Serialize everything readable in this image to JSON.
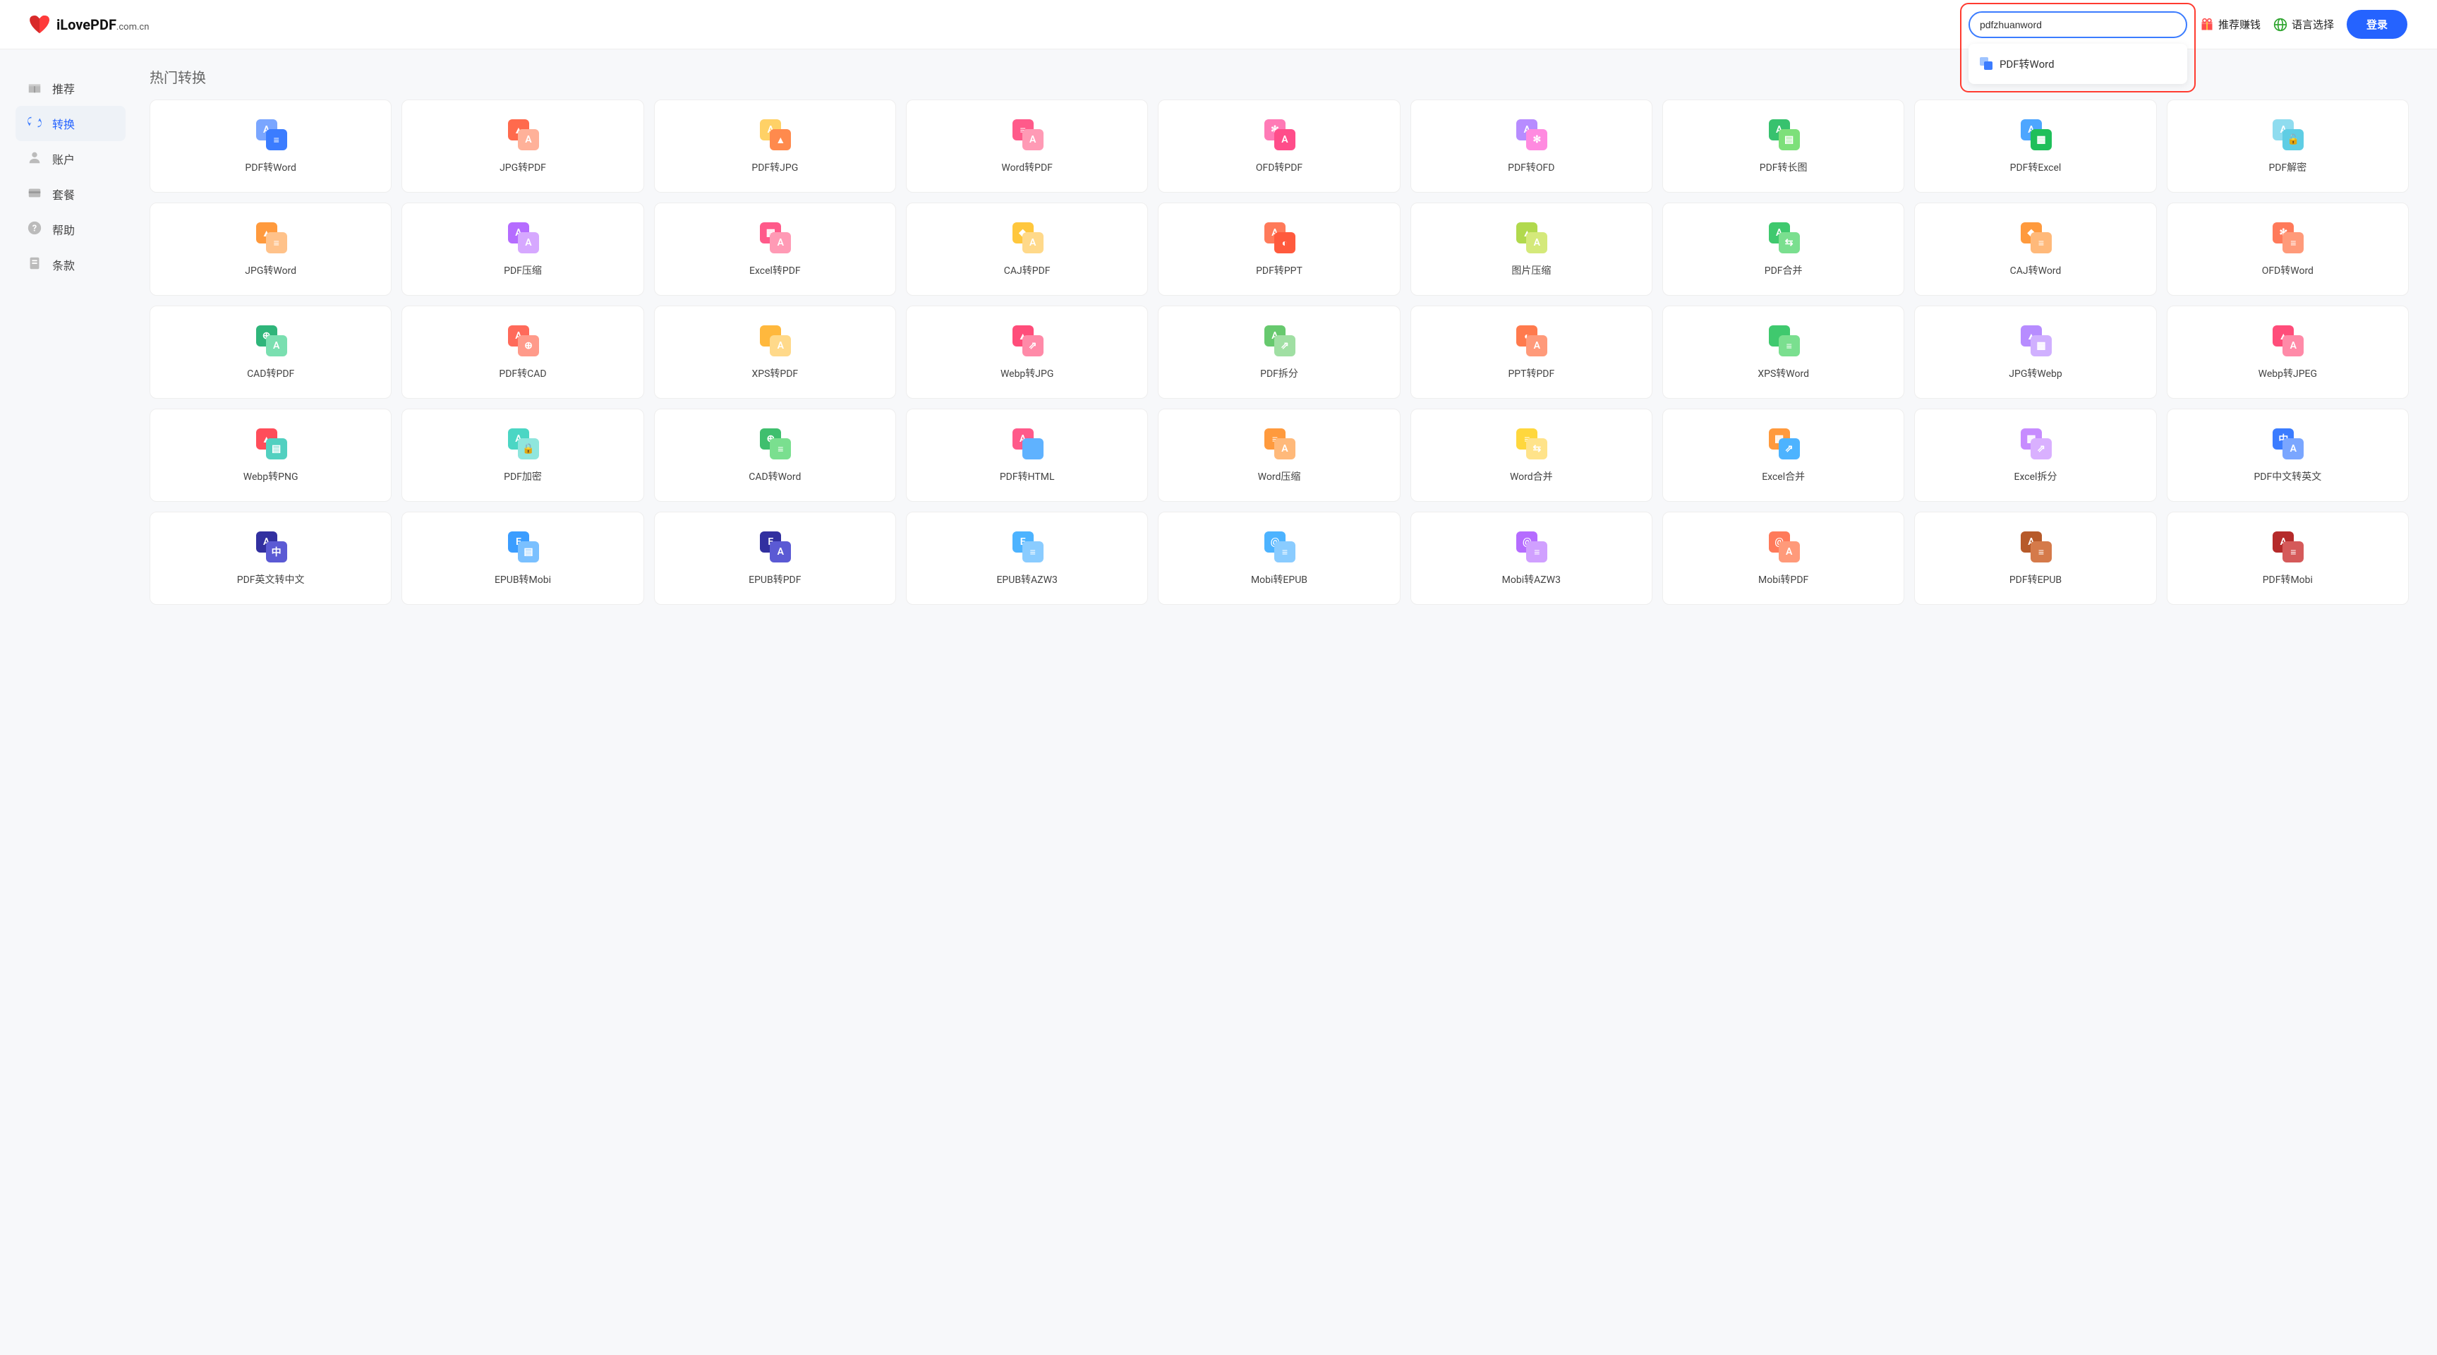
{
  "brand": {
    "name": "iLovePDF",
    "suffix": ".com.cn"
  },
  "header": {
    "search_value": "pdfzhuanword",
    "suggestion": "PDF转Word",
    "referral": "推荐赚钱",
    "language": "语言选择",
    "login": "登录"
  },
  "sidebar": {
    "items": [
      {
        "id": "recommend",
        "label": "推荐",
        "active": false
      },
      {
        "id": "convert",
        "label": "转换",
        "active": true
      },
      {
        "id": "account",
        "label": "账户",
        "active": false
      },
      {
        "id": "plans",
        "label": "套餐",
        "active": false
      },
      {
        "id": "help",
        "label": "帮助",
        "active": false
      },
      {
        "id": "terms",
        "label": "条款",
        "active": false
      }
    ]
  },
  "section_title": "热门转换",
  "tools": [
    {
      "label": "PDF转Word",
      "c1": "#7aa6ff",
      "c2": "#3b7cff",
      "g1": "A",
      "g2": "≡"
    },
    {
      "label": "JPG转PDF",
      "c1": "#ff6a4d",
      "c2": "#ffb199",
      "g1": "▲",
      "g2": "A"
    },
    {
      "label": "PDF转JPG",
      "c1": "#ffd166",
      "c2": "#ff8a4d",
      "g1": "A",
      "g2": "▲"
    },
    {
      "label": "Word转PDF",
      "c1": "#ff5a8a",
      "c2": "#ff9ab5",
      "g1": "≡",
      "g2": "A"
    },
    {
      "label": "OFD转PDF",
      "c1": "#ff7ab6",
      "c2": "#ff4d8a",
      "g1": "✻",
      "g2": "A"
    },
    {
      "label": "PDF转OFD",
      "c1": "#b78cff",
      "c2": "#ff8ae0",
      "g1": "A",
      "g2": "✻"
    },
    {
      "label": "PDF转长图",
      "c1": "#37c26e",
      "c2": "#7de07a",
      "g1": "A",
      "g2": "▤"
    },
    {
      "label": "PDF转Excel",
      "c1": "#4da6ff",
      "c2": "#1fbf5a",
      "g1": "A",
      "g2": "▦"
    },
    {
      "label": "PDF解密",
      "c1": "#8fdcef",
      "c2": "#5fcde4",
      "g1": "A",
      "g2": "🔓"
    },
    {
      "label": "JPG转Word",
      "c1": "#ff9a3d",
      "c2": "#ffc28a",
      "g1": "▲",
      "g2": "≡"
    },
    {
      "label": "PDF压缩",
      "c1": "#b56cff",
      "c2": "#d6a8ff",
      "g1": "A",
      "g2": "A"
    },
    {
      "label": "Excel转PDF",
      "c1": "#ff5a8a",
      "c2": "#ff9ab5",
      "g1": "▦",
      "g2": "A"
    },
    {
      "label": "CAJ转PDF",
      "c1": "#ffc73d",
      "c2": "#ffd98a",
      "g1": "◆",
      "g2": "A"
    },
    {
      "label": "PDF转PPT",
      "c1": "#ff7a5a",
      "c2": "#ff5a3d",
      "g1": "A",
      "g2": "◐"
    },
    {
      "label": "图片压缩",
      "c1": "#b1d94d",
      "c2": "#d4e97a",
      "g1": "▲",
      "g2": "A"
    },
    {
      "label": "PDF合并",
      "c1": "#3fc96e",
      "c2": "#7adf8f",
      "g1": "A",
      "g2": "⇆"
    },
    {
      "label": "CAJ转Word",
      "c1": "#ff9a3d",
      "c2": "#ffb97a",
      "g1": "◆",
      "g2": "≡"
    },
    {
      "label": "OFD转Word",
      "c1": "#ff7a5a",
      "c2": "#ff9a7a",
      "g1": "✻",
      "g2": "≡"
    },
    {
      "label": "CAD转PDF",
      "c1": "#2fb57a",
      "c2": "#7adfb0",
      "g1": "⊕",
      "g2": "A"
    },
    {
      "label": "PDF转CAD",
      "c1": "#ff6a5a",
      "c2": "#ff9a8a",
      "g1": "A",
      "g2": "⊕"
    },
    {
      "label": "XPS转PDF",
      "c1": "#ffb83d",
      "c2": "#ffd98a",
      "g1": "</>",
      "g2": "A"
    },
    {
      "label": "Webp转JPG",
      "c1": "#ff4d7a",
      "c2": "#ff8aa8",
      "g1": "▲",
      "g2": "⇗"
    },
    {
      "label": "PDF拆分",
      "c1": "#67c96e",
      "c2": "#a0dfa3",
      "g1": "A",
      "g2": "⇗"
    },
    {
      "label": "PPT转PDF",
      "c1": "#ff7a4d",
      "c2": "#ff9a7a",
      "g1": "◐",
      "g2": "A"
    },
    {
      "label": "XPS转Word",
      "c1": "#3fc96e",
      "c2": "#7adf8f",
      "g1": "</>",
      "g2": "≡"
    },
    {
      "label": "JPG转Webp",
      "c1": "#b78cff",
      "c2": "#d0b0ff",
      "g1": "▲",
      "g2": "▦"
    },
    {
      "label": "Webp转JPEG",
      "c1": "#ff4d7a",
      "c2": "#ff8aa8",
      "g1": "▲",
      "g2": "A"
    },
    {
      "label": "Webp转PNG",
      "c1": "#ff4d5a",
      "c2": "#52d0c0",
      "g1": "▲",
      "g2": "▤"
    },
    {
      "label": "PDF加密",
      "c1": "#4bd6c4",
      "c2": "#8fe6dd",
      "g1": "A",
      "g2": "🔒"
    },
    {
      "label": "CAD转Word",
      "c1": "#3fbf6e",
      "c2": "#7adf8f",
      "g1": "⊕",
      "g2": "≡"
    },
    {
      "label": "PDF转HTML",
      "c1": "#ff5a8a",
      "c2": "#5fb2ff",
      "g1": "A",
      "g2": "</>"
    },
    {
      "label": "Word压缩",
      "c1": "#ff9a3d",
      "c2": "#ffb97a",
      "g1": "≡",
      "g2": "A"
    },
    {
      "label": "Word合并",
      "c1": "#ffd73d",
      "c2": "#ffe38a",
      "g1": "≡",
      "g2": "⇆"
    },
    {
      "label": "Excel合并",
      "c1": "#ff9a3d",
      "c2": "#4db3ff",
      "g1": "▦",
      "g2": "⇗"
    },
    {
      "label": "Excel拆分",
      "c1": "#c78cff",
      "c2": "#d9b0ff",
      "g1": "▦",
      "g2": "⇗"
    },
    {
      "label": "PDF中文转英文",
      "c1": "#3b7cff",
      "c2": "#7aa6ff",
      "g1": "中",
      "g2": "A"
    },
    {
      "label": "PDF英文转中文",
      "c1": "#3230a0",
      "c2": "#5b5ad4",
      "g1": "A",
      "g2": "中"
    },
    {
      "label": "EPUB转Mobi",
      "c1": "#3b9dff",
      "c2": "#7ac0ff",
      "g1": "E",
      "g2": "▤"
    },
    {
      "label": "EPUB转PDF",
      "c1": "#3230a0",
      "c2": "#5b5ad4",
      "g1": "E",
      "g2": "A"
    },
    {
      "label": "EPUB转AZW3",
      "c1": "#4db3ff",
      "c2": "#8accff",
      "g1": "E",
      "g2": "≡"
    },
    {
      "label": "Mobi转EPUB",
      "c1": "#4db3ff",
      "c2": "#8accff",
      "g1": "@",
      "g2": "≡"
    },
    {
      "label": "Mobi转AZW3",
      "c1": "#b56cff",
      "c2": "#d0a0ff",
      "g1": "@",
      "g2": "≡"
    },
    {
      "label": "Mobi转PDF",
      "c1": "#ff7a5a",
      "c2": "#ff9a7a",
      "g1": "@",
      "g2": "A"
    },
    {
      "label": "PDF转EPUB",
      "c1": "#b75a2a",
      "c2": "#d57a4a",
      "g1": "A",
      "g2": "≡"
    },
    {
      "label": "PDF转Mobi",
      "c1": "#b52a2a",
      "c2": "#d55a5a",
      "g1": "A",
      "g2": "≡"
    }
  ]
}
